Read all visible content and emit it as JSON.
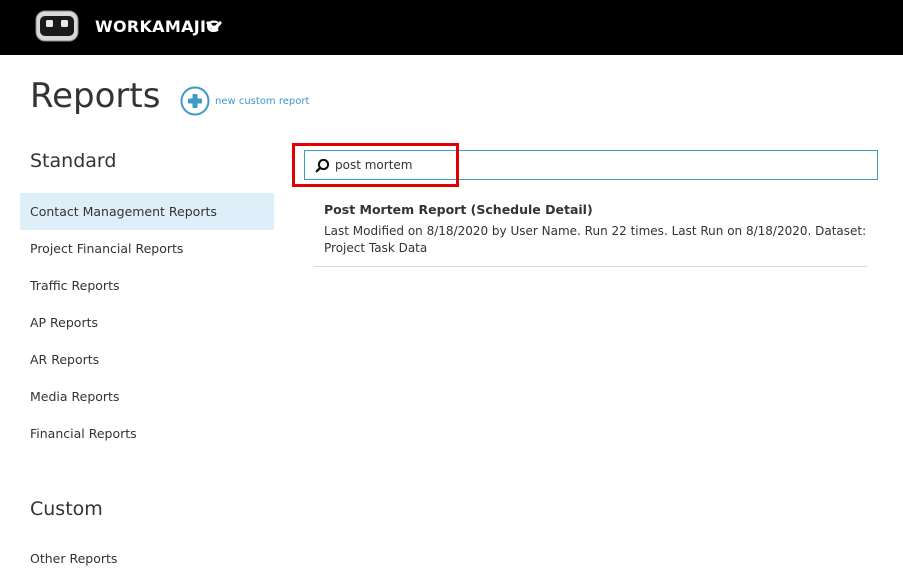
{
  "app": {
    "name": "WORKAMAJIG"
  },
  "page": {
    "title": "Reports",
    "new_custom_report_label": "new custom report"
  },
  "sidebar": {
    "standard_heading": "Standard",
    "standard_items": [
      {
        "label": "Contact Management Reports",
        "active": true
      },
      {
        "label": "Project Financial Reports",
        "active": false
      },
      {
        "label": "Traffic Reports",
        "active": false
      },
      {
        "label": "AP Reports",
        "active": false
      },
      {
        "label": "AR Reports",
        "active": false
      },
      {
        "label": "Media Reports",
        "active": false
      },
      {
        "label": "Financial Reports",
        "active": false
      }
    ],
    "custom_heading": "Custom",
    "custom_items": [
      {
        "label": "Other Reports",
        "active": false
      }
    ]
  },
  "search": {
    "value": "post mortem"
  },
  "results": [
    {
      "title": "Post Mortem Report (Schedule Detail)",
      "description": "Last Modified on 8/18/2020 by User Name. Run 22 times. Last Run on 8/18/2020. Dataset: Project Task Data"
    }
  ],
  "colors": {
    "topbar": "#000000",
    "accent": "#3d9ac7",
    "active_item_bg": "#dfeff9",
    "highlight_border": "#e00000",
    "text": "#333333"
  },
  "icons": {
    "logo": "robot-logo-icon",
    "app_menu": "chevron-down-icon",
    "add": "plus-circle-icon",
    "search": "search-icon"
  }
}
